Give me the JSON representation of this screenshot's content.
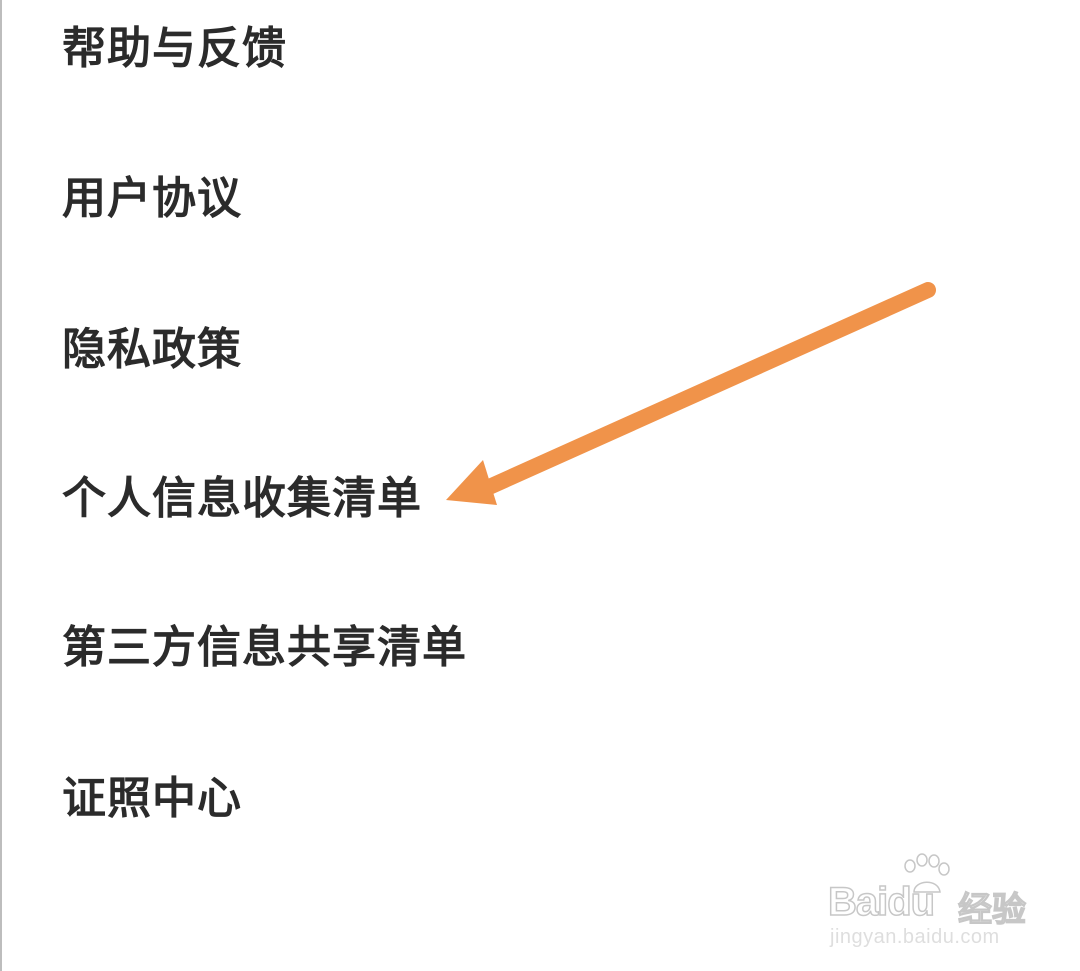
{
  "menu": {
    "items": [
      {
        "label": "帮助与反馈"
      },
      {
        "label": "用户协议"
      },
      {
        "label": "隐私政策"
      },
      {
        "label": "个人信息收集清单"
      },
      {
        "label": "第三方信息共享清单"
      },
      {
        "label": "证照中心"
      }
    ]
  },
  "annotation": {
    "arrow_color": "#F0934A",
    "arrow_target": "个人信息收集清单"
  },
  "watermark": {
    "logo_text": "Baidu",
    "product_text": "经验",
    "url": "jingyan.baidu.com"
  }
}
